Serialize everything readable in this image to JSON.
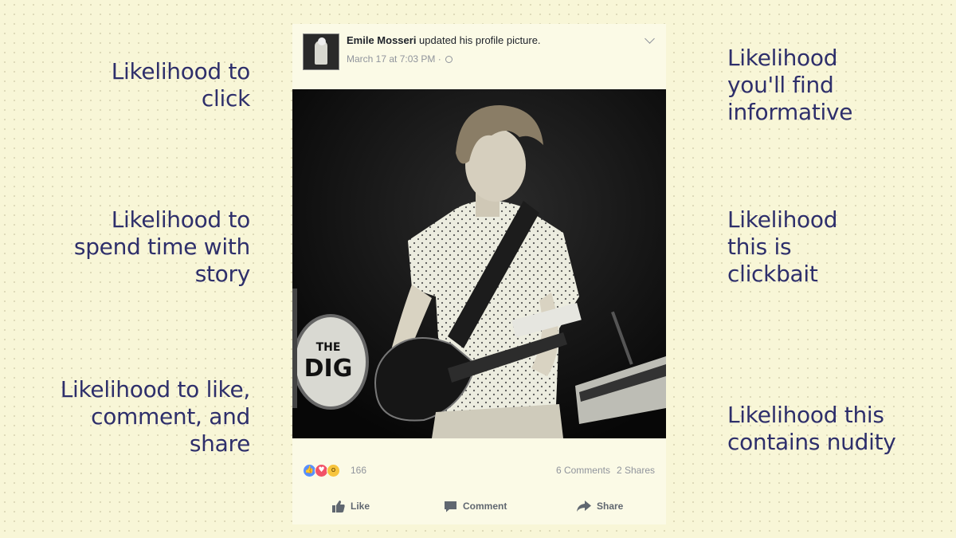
{
  "left_labels": [
    {
      "text": "Likelihood to\nclick"
    },
    {
      "text": "Likelihood to\nspend time with\nstory"
    },
    {
      "text": "Likelihood to like,\ncomment, and\nshare"
    }
  ],
  "right_labels": [
    {
      "text": "Likelihood\nyou'll find\ninformative"
    },
    {
      "text": "Likelihood\nthis is\nclickbait"
    },
    {
      "text": "Likelihood this\ncontains nudity"
    }
  ],
  "post": {
    "author": "Emile Mosseri",
    "action_text": " updated his profile picture.",
    "timestamp": "March 17 at 7:03 PM · ",
    "drum_text": "THE DIG",
    "reaction_count": "166",
    "comments": "6 Comments",
    "shares": "2 Shares",
    "actions": {
      "like": "Like",
      "comment": "Comment",
      "share": "Share"
    }
  },
  "colors": {
    "background": "#f8f6d7",
    "label_text": "#2e2f6b",
    "like_blue": "#5890ff",
    "love_red": "#f25268",
    "wow_yellow": "#f7c43d"
  }
}
